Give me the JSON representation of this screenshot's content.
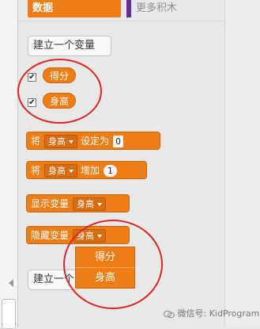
{
  "categories": {
    "data_label": "数据",
    "more_blocks_label": "更多积木"
  },
  "buttons": {
    "make_variable": "建立一个变量",
    "make_list_partial": "建立一个"
  },
  "variables": [
    {
      "name": "得分",
      "checked": true
    },
    {
      "name": "身高",
      "checked": true
    }
  ],
  "blocks": {
    "set": {
      "prefix": "将",
      "var": "身高",
      "suffix": "设定为",
      "value": "0"
    },
    "change": {
      "prefix": "将",
      "var": "身高",
      "suffix": "增加",
      "value": "1"
    },
    "show": {
      "prefix": "显示变量",
      "var": "身高"
    },
    "hide": {
      "prefix": "隐藏变量",
      "var": "身高"
    }
  },
  "dropdown_menu": {
    "options": [
      "得分",
      "身高"
    ]
  },
  "watermark": {
    "text": "微信号: KidProgram"
  },
  "colors": {
    "data_orange": "#ee7d16",
    "more_blocks_purple": "#632d99",
    "annotation_red": "#e02424"
  }
}
